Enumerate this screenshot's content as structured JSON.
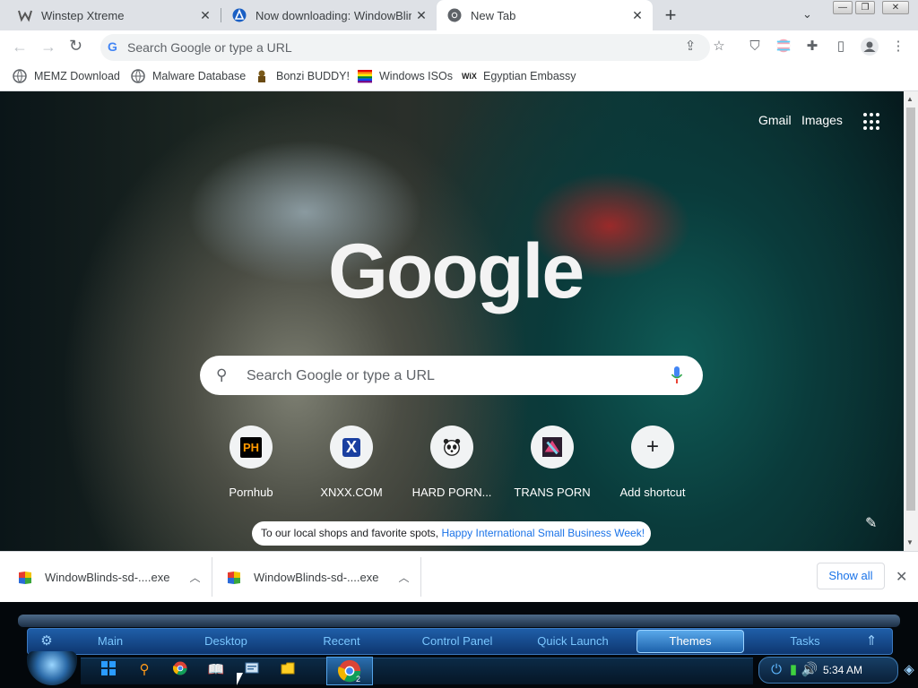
{
  "tabs": [
    {
      "title": "Winstep Xtreme",
      "active": false
    },
    {
      "title": "Now downloading: WindowBlinds",
      "active": false
    },
    {
      "title": "New Tab",
      "active": true
    }
  ],
  "omnibox": {
    "placeholder": "Search Google or type a URL"
  },
  "bookmarks": [
    {
      "label": "MEMZ Download"
    },
    {
      "label": "Malware Database"
    },
    {
      "label": "Bonzi BUDDY!"
    },
    {
      "label": "Windows ISOs"
    },
    {
      "label": "Egyptian Embassy"
    }
  ],
  "ntp": {
    "gmail": "Gmail",
    "images": "Images",
    "logo": "Google",
    "search_placeholder": "Search Google or type a URL",
    "shortcuts": [
      {
        "label": "Pornhub",
        "icon_text": "PH"
      },
      {
        "label": "XNXX.COM",
        "icon_text": "X"
      },
      {
        "label": "HARD PORN...",
        "icon_text": ""
      },
      {
        "label": "TRANS PORN",
        "icon_text": ""
      },
      {
        "label": "Add shortcut",
        "icon_text": "+"
      }
    ],
    "promo_text": "To our local shops and favorite spots,",
    "promo_link": "Happy International Small Business Week!"
  },
  "downloads": {
    "items": [
      {
        "name": "WindowBlinds-sd-....exe"
      },
      {
        "name": "WindowBlinds-sd-....exe"
      }
    ],
    "show_all": "Show all"
  },
  "taskbar": {
    "menu": [
      "Main",
      "Desktop",
      "Recent",
      "Control Panel",
      "Quick Launch",
      "Themes",
      "Tasks"
    ],
    "selected": "Themes",
    "clock": "5:34 AM",
    "chrome_badge": "2"
  },
  "colors": {
    "accent": "#1a73e8",
    "taskbar_blue": "#1f5ea8",
    "taskbar_text": "#79c6ff"
  }
}
